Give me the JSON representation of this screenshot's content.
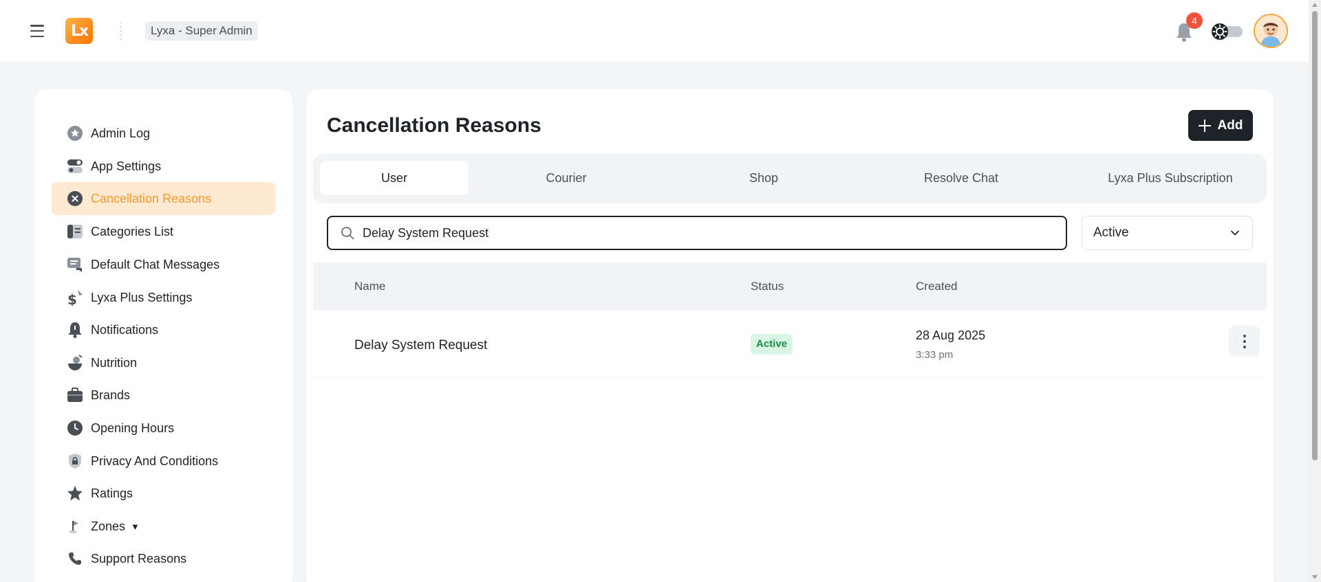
{
  "header": {
    "menu_icon": "hamburger-icon",
    "logo_text": "Lx",
    "workspace_label": "Lyxa - Super Admin",
    "notification_count": "4",
    "icons": {
      "bell": "bell-icon",
      "theme": "sun-icon",
      "avatar": "user-avatar"
    }
  },
  "sidebar": {
    "items": [
      {
        "label": "Admin Log",
        "icon": "star-badge-icon",
        "active": false
      },
      {
        "label": "App Settings",
        "icon": "toggle-icon",
        "active": false
      },
      {
        "label": "Cancellation Reasons",
        "icon": "cancel-circle-icon",
        "active": true
      },
      {
        "label": "Categories List",
        "icon": "list-icon",
        "active": false
      },
      {
        "label": "Default Chat Messages",
        "icon": "chat-icon",
        "active": false
      },
      {
        "label": "Lyxa Plus Settings",
        "icon": "dollar-icon",
        "active": false
      },
      {
        "label": "Notifications",
        "icon": "bell-icon",
        "active": false
      },
      {
        "label": "Nutrition",
        "icon": "nutrition-icon",
        "active": false
      },
      {
        "label": "Brands",
        "icon": "briefcase-icon",
        "active": false
      },
      {
        "label": "Opening Hours",
        "icon": "clock-icon",
        "active": false
      },
      {
        "label": "Privacy And Conditions",
        "icon": "lock-shield-icon",
        "active": false
      },
      {
        "label": "Ratings",
        "icon": "star-icon",
        "active": false
      },
      {
        "label": "Zones",
        "icon": "flag-icon",
        "active": false,
        "caret": "▼"
      },
      {
        "label": "Support Reasons",
        "icon": "phone-icon",
        "active": false
      }
    ]
  },
  "main": {
    "title": "Cancellation Reasons",
    "add_label": "Add",
    "tabs": [
      {
        "label": "User",
        "active": true
      },
      {
        "label": "Courier",
        "active": false
      },
      {
        "label": "Shop",
        "active": false
      },
      {
        "label": "Resolve Chat",
        "active": false
      },
      {
        "label": "Lyxa Plus Subscription",
        "active": false
      }
    ],
    "search": {
      "value": "Delay System Request",
      "placeholder": ""
    },
    "status_filter": {
      "selected": "Active"
    },
    "table": {
      "columns": [
        "Name",
        "Status",
        "Created"
      ],
      "rows": [
        {
          "name": "Delay System Request",
          "status": "Active",
          "date": "28 Aug 2025",
          "time": "3:33 pm"
        }
      ]
    }
  },
  "colors": {
    "accent": "#f59a2c",
    "active_bg": "#ffe9d2",
    "dark_button": "#1e2328",
    "badge_red": "#f0533a",
    "status_green": "#1a8a4a",
    "status_green_bg": "#d9f5e3"
  }
}
